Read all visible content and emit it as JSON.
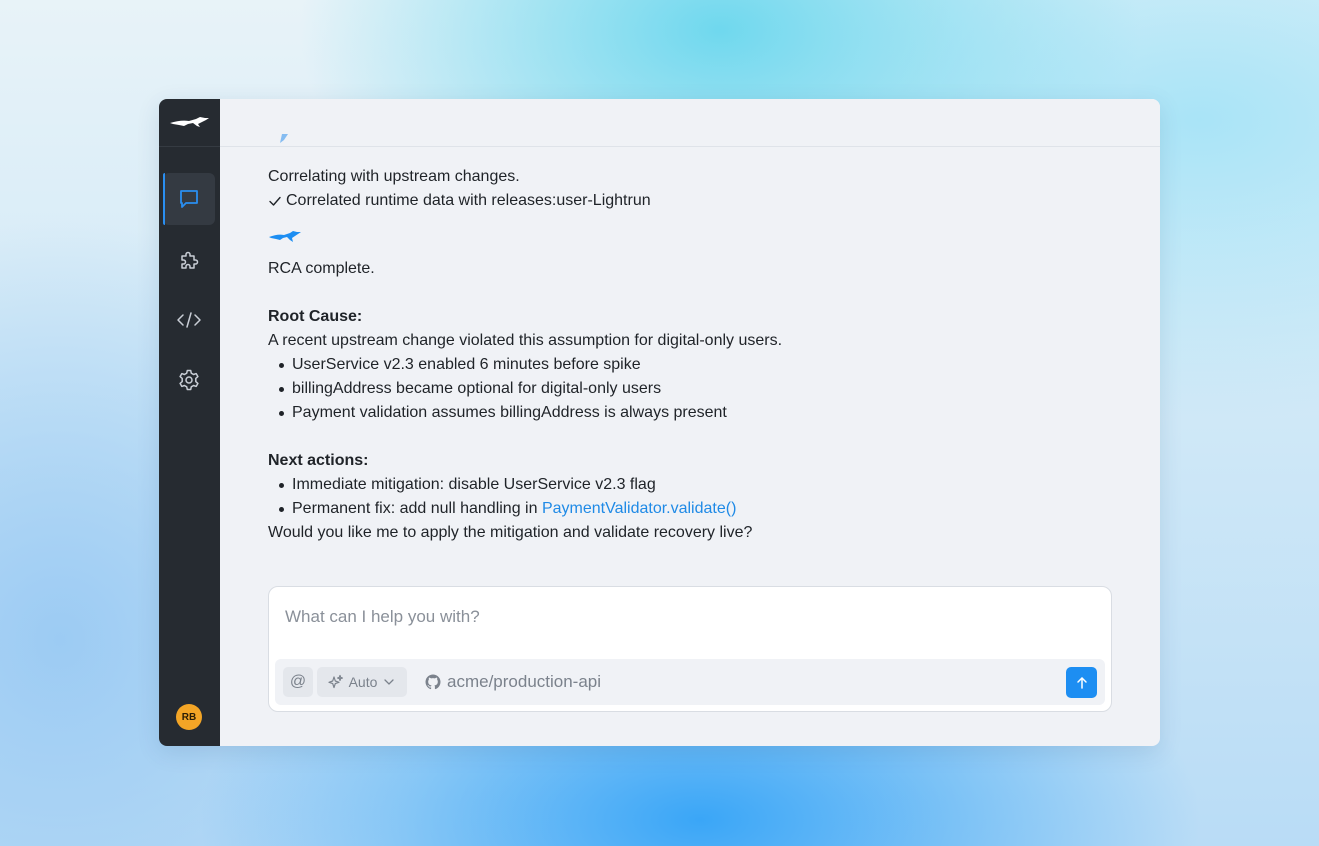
{
  "sidebar": {
    "items": [
      {
        "name": "chat",
        "icon": "chat-bubble-icon",
        "active": true
      },
      {
        "name": "extensions",
        "icon": "puzzle-icon",
        "active": false
      },
      {
        "name": "code",
        "icon": "code-icon",
        "active": false
      },
      {
        "name": "settings",
        "icon": "gear-icon",
        "active": false
      }
    ],
    "avatar_initials": "RB",
    "logo_icon": "cheetah-logo-icon"
  },
  "conversation": {
    "correlating_text": "Correlating with upstream changes.",
    "correlated_check": "Correlated runtime data with releases:user-Lightrun",
    "rca_complete": "RCA complete.",
    "root_cause_heading": "Root Cause:",
    "root_cause_summary": "A recent upstream change violated this assumption for digital-only users.",
    "root_cause_bullets": [
      "UserService v2.3 enabled 6 minutes before spike",
      "billingAddress became optional for digital-only users",
      "Payment validation assumes billingAddress is always present"
    ],
    "next_actions_heading": "Next actions:",
    "next_action_1": "Immediate mitigation: disable UserService v2.3 flag",
    "next_action_2_prefix": "Permanent fix: add null handling in ",
    "next_action_2_link": "PaymentValidator.validate()",
    "question": "Would you like me to apply the mitigation and validate recovery live?"
  },
  "composer": {
    "placeholder": "What can I help you with?",
    "mention_symbol": "@",
    "model_label": "Auto",
    "repo": "acme/production-api"
  },
  "colors": {
    "accent": "#1d8ef2",
    "sidebar_bg": "#262b31",
    "avatar": "#f3a526"
  }
}
